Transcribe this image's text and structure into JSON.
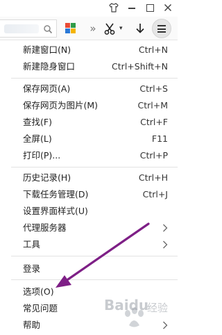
{
  "colors": {
    "annotation_arrow": "#7e1f86",
    "menu_background": "#ffffff",
    "separator": "#e2e2e2",
    "text": "#222222"
  },
  "icons": {
    "titlebar": [
      "shirt-icon",
      "minimize-icon",
      "restore-icon",
      "close-icon"
    ],
    "toolbar": [
      "search-icon",
      "apps-icon",
      "chevron-double-right-icon",
      "scissors-icon",
      "dropdown-caret-icon",
      "download-icon",
      "menu-icon"
    ]
  },
  "toolbar": {
    "more_symbol": "»",
    "scissors_caret": "▾"
  },
  "menu": {
    "groups": [
      [
        {
          "label": "新建窗口(N)",
          "shortcut": "Ctrl+N"
        },
        {
          "label": "新建隐身窗口",
          "shortcut": "Ctrl+Shift+N"
        }
      ],
      [
        {
          "label": "保存网页(A)",
          "shortcut": "Ctrl+S"
        },
        {
          "label": "保存网页为图片(M)",
          "shortcut": "Ctrl+M"
        },
        {
          "label": "查找(F)",
          "shortcut": "Ctrl+F"
        },
        {
          "label": "全屏(L)",
          "shortcut": "F11"
        },
        {
          "label": "打印(P)...",
          "shortcut": "Ctrl+P"
        }
      ],
      [
        {
          "label": "历史记录(H)",
          "shortcut": "Ctrl+H"
        },
        {
          "label": "下载任务管理(D)",
          "shortcut": "Ctrl+J"
        },
        {
          "label": "设置界面样式(U)",
          "shortcut": ""
        },
        {
          "label": "代理服务器",
          "shortcut": "",
          "submenu": true
        },
        {
          "label": "工具",
          "shortcut": "",
          "submenu": true
        }
      ],
      [
        {
          "label": "登录",
          "shortcut": ""
        }
      ],
      [
        {
          "label": "选项(O)",
          "shortcut": ""
        },
        {
          "label": "常见问题",
          "shortcut": ""
        },
        {
          "label": "帮助",
          "shortcut": "",
          "submenu": true
        }
      ]
    ]
  },
  "watermark": {
    "brand": "Baidu",
    "text": "经验"
  }
}
